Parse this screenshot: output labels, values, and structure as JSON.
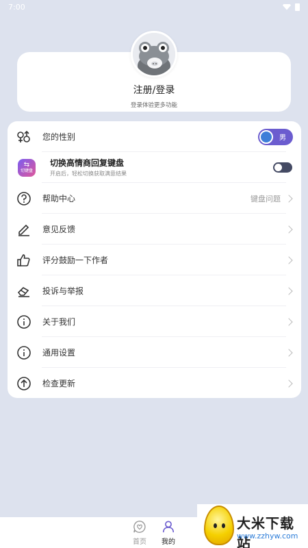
{
  "status_bar": {
    "time": "7:00"
  },
  "profile": {
    "title": "注册/登录",
    "subtitle": "登录体验更多功能"
  },
  "menu": {
    "gender": {
      "label": "您的性别",
      "value": "男"
    },
    "keyboard": {
      "title": "切换高情商回复键盘",
      "subtitle": "开启后，轻松切换获取满意结果",
      "icon_text": "切键盘",
      "enabled": false
    },
    "items": [
      {
        "label": "帮助中心",
        "right": "键盘问题",
        "icon": "question-circle-icon"
      },
      {
        "label": "意见反馈",
        "right": "",
        "icon": "pencil-icon"
      },
      {
        "label": "评分鼓励一下作者",
        "right": "",
        "icon": "thumbs-up-icon"
      },
      {
        "label": "投诉与举报",
        "right": "",
        "icon": "eraser-icon"
      },
      {
        "label": "关于我们",
        "right": "",
        "icon": "info-circle-icon"
      },
      {
        "label": "通用设置",
        "right": "",
        "icon": "info-circle-icon"
      },
      {
        "label": "检查更新",
        "right": "",
        "icon": "arrow-up-circle-icon"
      }
    ]
  },
  "tabbar": {
    "tabs": [
      {
        "label": "首页",
        "active": false
      },
      {
        "label": "我的",
        "active": true
      }
    ]
  },
  "watermark": {
    "title": "大米下载站",
    "url": "www.zzhyw.com"
  },
  "colors": {
    "background": "#dde2ee",
    "accent": "#6b5ccf",
    "toggle_off": "#444a63"
  }
}
